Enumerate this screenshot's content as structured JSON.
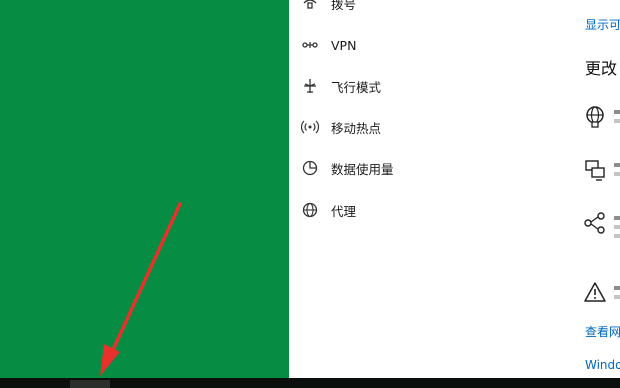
{
  "nav": {
    "items": [
      {
        "label": "拨号",
        "icon": "dial-up-icon"
      },
      {
        "label": "VPN",
        "icon": "vpn-icon"
      },
      {
        "label": "飞行模式",
        "icon": "airplane-icon"
      },
      {
        "label": "移动热点",
        "icon": "hotspot-icon"
      },
      {
        "label": "数据使用量",
        "icon": "data-usage-icon"
      },
      {
        "label": "代理",
        "icon": "globe-icon"
      }
    ]
  },
  "content": {
    "show_link": "显示可",
    "change_title": "更改",
    "options": [
      {
        "icon": "network-adapter-icon"
      },
      {
        "icon": "sharing-center-icon"
      },
      {
        "icon": "homegroup-icon"
      },
      {
        "icon": "troubleshoot-warning-icon"
      }
    ],
    "view_link": "查看网",
    "windows_link": "Windo"
  },
  "colors": {
    "desktop": "#078c43",
    "accent_link": "#0067c0",
    "arrow": "#e8312a"
  }
}
